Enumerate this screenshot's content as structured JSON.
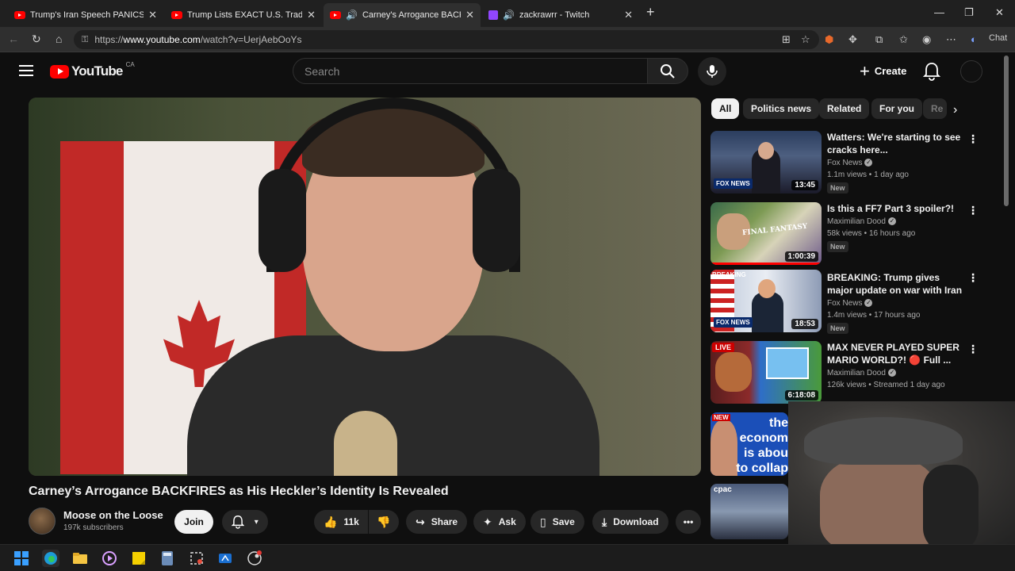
{
  "browser": {
    "tabs": [
      {
        "title": "Trump's Iran Speech PANICS The M",
        "icon": "youtube-icon"
      },
      {
        "title": "Trump Lists EXACT U.S. Trade Deal",
        "icon": "youtube-icon"
      },
      {
        "title": "Carney's Arrogance BACKFIRE",
        "icon": "youtube-icon"
      },
      {
        "title": "zackrawrr - Twitch",
        "icon": "twitch-icon"
      }
    ],
    "url_prefix": "https://",
    "url_host": "www.youtube.com",
    "url_path": "/watch?v=UerjAebOoYs",
    "chat_label": "Chat"
  },
  "youtube": {
    "logo_text": "YouTube",
    "country": "CA",
    "search_placeholder": "Search",
    "create_label": "Create"
  },
  "video": {
    "title": "Carney’s Arrogance BACKFIRES as His Heckler’s Identity Is Revealed",
    "channel": "Moose on the Loose",
    "subscribers": "197k subscribers",
    "join_label": "Join",
    "likes": "11k",
    "share_label": "Share",
    "ask_label": "Ask",
    "save_label": "Save",
    "download_label": "Download"
  },
  "chips": [
    "All",
    "Politics news",
    "Related",
    "For you",
    "Re"
  ],
  "recommendations": [
    {
      "title": "Watters: We're starting to see cracks here...",
      "channel": "Fox News",
      "meta": "1.1m views • 1 day ago",
      "badge": "New",
      "duration": "13:45"
    },
    {
      "title": "Is this a FF7 Part 3 spoiler?!",
      "channel": "Maximilian Dood",
      "meta": "58k views • 16 hours ago",
      "badge": "New",
      "duration": "1:00:39"
    },
    {
      "title": "BREAKING: Trump gives major update on war with Iran",
      "channel": "Fox News",
      "meta": "1.4m views • 17 hours ago",
      "badge": "New",
      "duration": "18:53",
      "thumb_tag": "BREAKING"
    },
    {
      "title": "MAX NEVER PLAYED SUPER MARIO WORLD?! 🔴 Full ...",
      "channel": "Maximilian Dood",
      "meta": "126k views • Streamed 1 day ago",
      "duration": "6:18:08",
      "live_tag": "LIVE"
    },
    {
      "thumb_text": "the econom is abou to collap",
      "thumb_tag": "NEW"
    },
    {
      "thumb_tag": "cpac"
    }
  ],
  "thumb_text": {
    "fox": "FOX NEWS",
    "ff": "FINAL FANTASY"
  },
  "colors": {
    "youtube_red": "#ff0000",
    "background": "#0f0f0f",
    "chip_bg": "#272727",
    "twitch_purple": "#9146ff"
  }
}
